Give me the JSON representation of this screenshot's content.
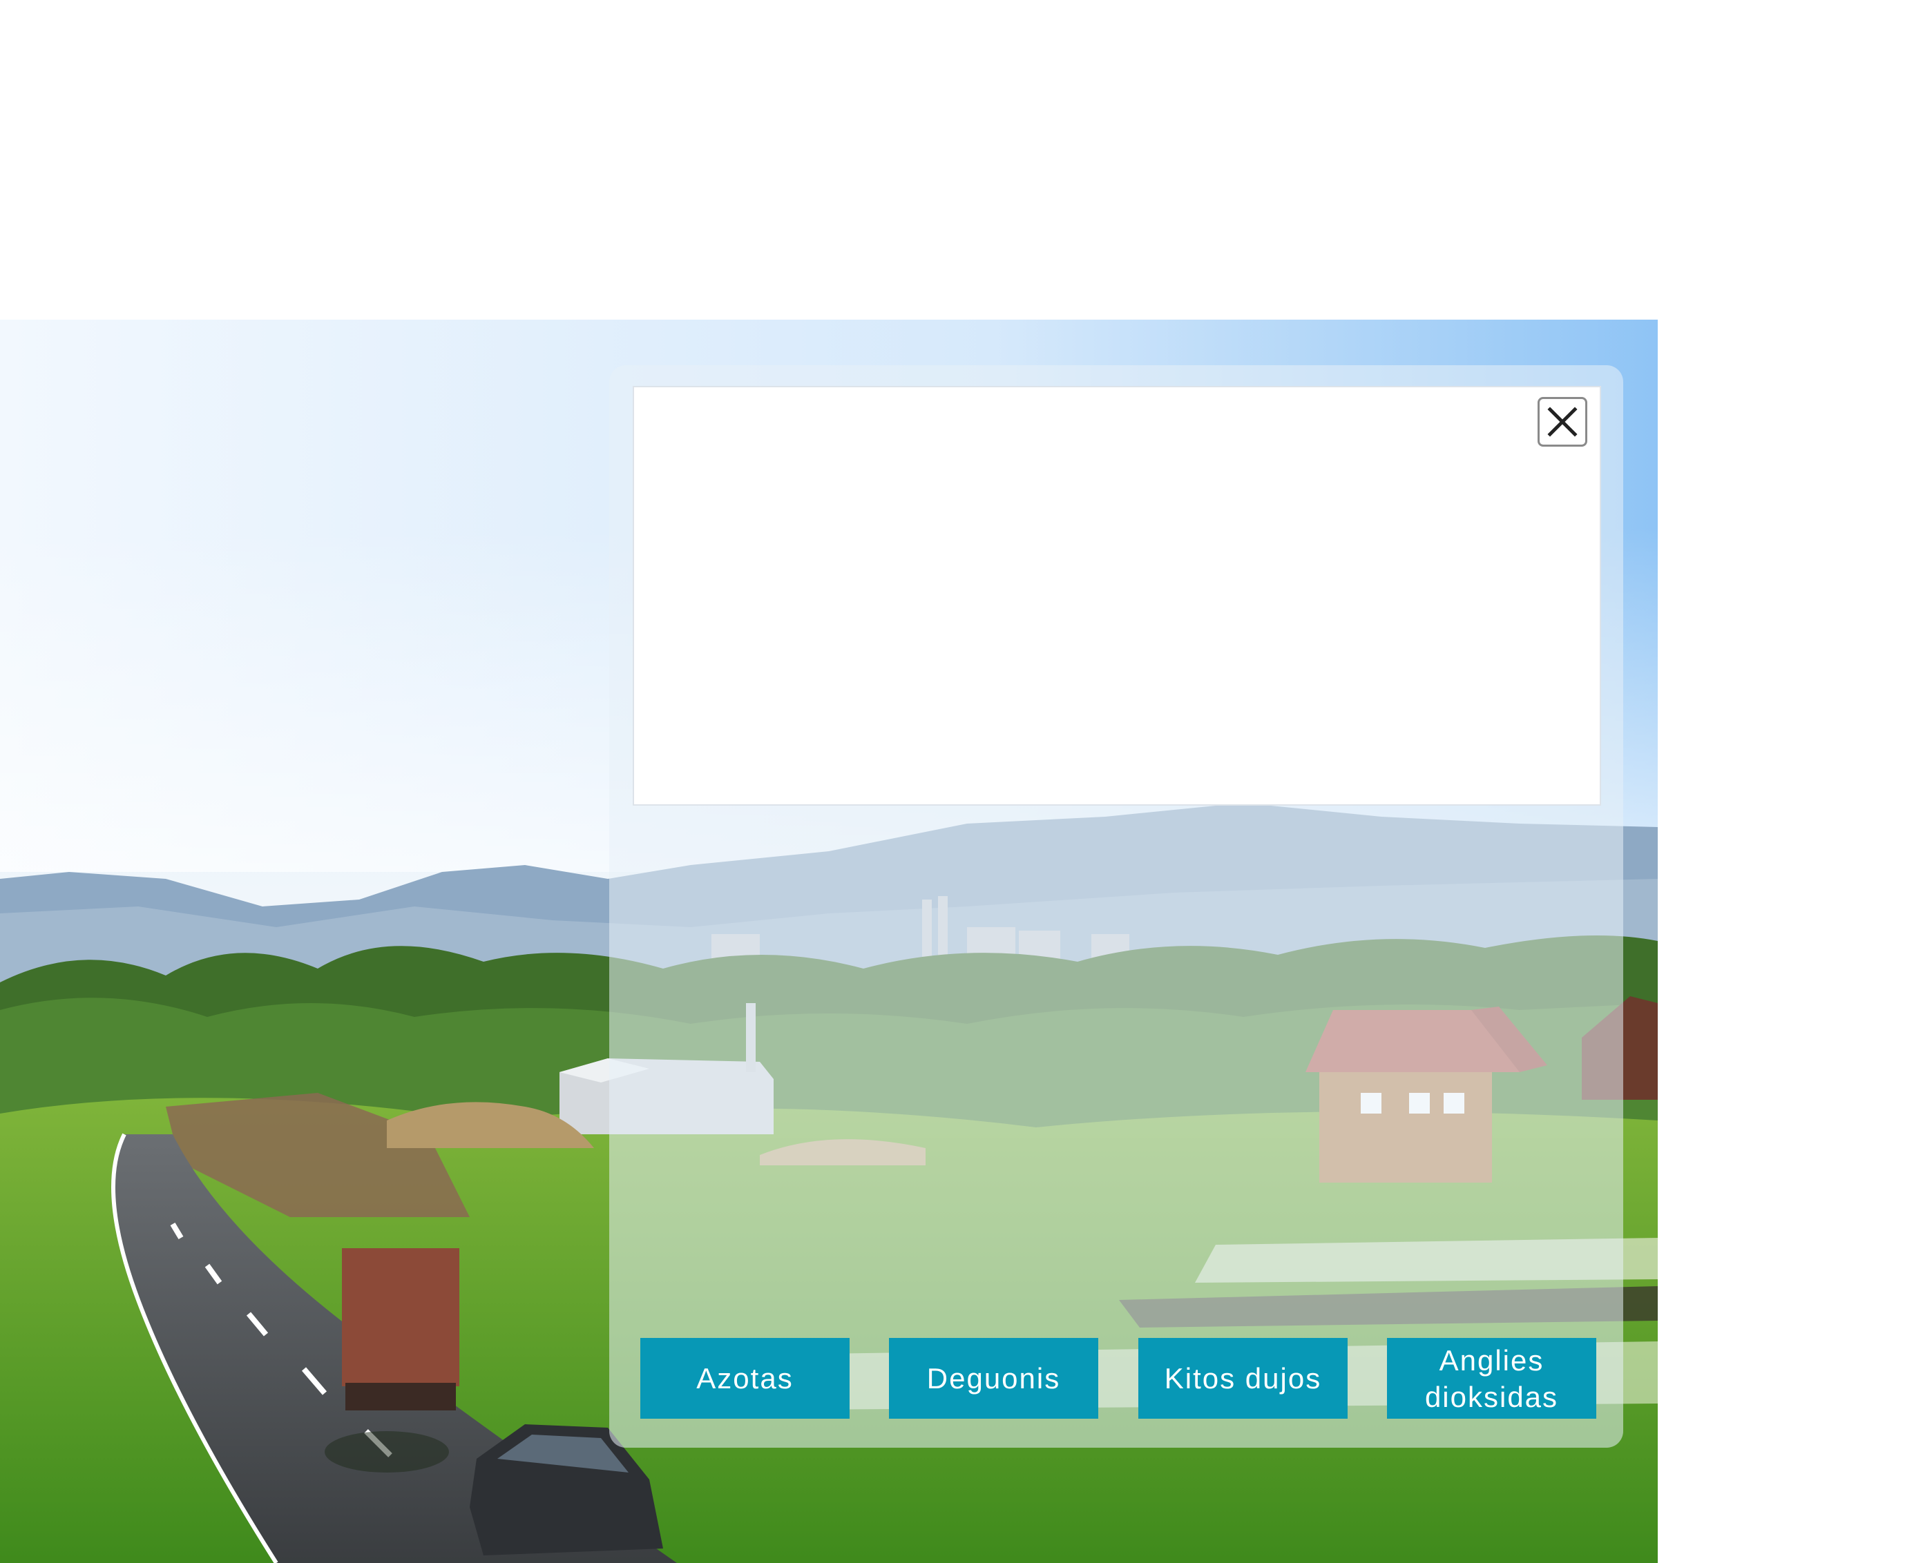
{
  "colors": {
    "button_background": "#0798b6",
    "button_text": "#ffffff",
    "close_icon": "#222222"
  },
  "modal": {
    "close_icon": "close-icon",
    "buttons": [
      {
        "label": "Azotas"
      },
      {
        "label": "Deguonis"
      },
      {
        "label": "Kitos dujos"
      },
      {
        "label": "Anglies dioksidas"
      }
    ]
  }
}
